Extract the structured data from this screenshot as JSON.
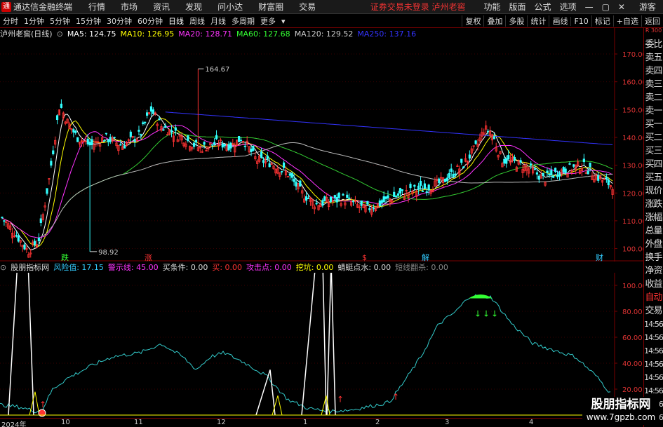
{
  "app": {
    "title": "通达信金融终端",
    "menu": [
      "行情",
      "市场",
      "资讯",
      "发现",
      "问小达",
      "财富圈",
      "交易"
    ],
    "notice": "证券交易未登录  泸州老窖",
    "right_menu": [
      "功能",
      "版面",
      "公式",
      "选项"
    ],
    "guest": "游客"
  },
  "toolbar": {
    "periods": [
      "分时",
      "1分钟",
      "5分钟",
      "15分钟",
      "30分钟",
      "60分钟",
      "日线",
      "周线",
      "月线",
      "多周期",
      "更多"
    ],
    "active_period": "日线",
    "right_buttons": [
      "复权",
      "叠加",
      "多股",
      "统计",
      "画线",
      "F10",
      "标记",
      "+自选",
      "返回"
    ]
  },
  "main_chart": {
    "stock": "泸州老窖(日线)",
    "ma": [
      {
        "label": "MA5: 124.75",
        "color": "#ffffff"
      },
      {
        "label": "MA10: 126.95",
        "color": "#ffff00"
      },
      {
        "label": "MA20: 128.71",
        "color": "#ff33ff"
      },
      {
        "label": "MA60: 127.68",
        "color": "#33ff33"
      },
      {
        "label": "MA120: 129.52",
        "color": "#cccccc"
      },
      {
        "label": "MA250: 137.16",
        "color": "#3333ff"
      }
    ],
    "price_axis": [
      "170.00",
      "160.00",
      "150.00",
      "140.00",
      "130.00",
      "120.00",
      "110.00",
      "100.00"
    ],
    "high_label": "164.67",
    "low_label": "98.92",
    "markers": [
      {
        "text": "跌",
        "color": "#33ff33"
      },
      {
        "text": "涨",
        "color": "#ff3333"
      },
      {
        "text": "$",
        "color": "#ff3333"
      },
      {
        "text": "解",
        "color": "#33ccff"
      },
      {
        "text": "财",
        "color": "#33ccff"
      }
    ]
  },
  "sub_chart": {
    "name": "股朋指标网",
    "fields": [
      {
        "label": "风险值: 17.15",
        "color": "#33ccff"
      },
      {
        "label": "警示线: 45.00",
        "color": "#ff33ff"
      },
      {
        "label": "买条件: 0.00",
        "color": "#dddddd"
      },
      {
        "label": "买: 0.00",
        "color": "#ff3333"
      },
      {
        "label": "攻击点: 0.00",
        "color": "#ff33ff"
      },
      {
        "label": "挖坑: 0.00",
        "color": "#ffff00"
      },
      {
        "label": "蜻蜓点水: 0.00",
        "color": "#dddddd"
      },
      {
        "label": "短线翻杀: 0.00",
        "color": "#888888"
      }
    ],
    "axis": [
      "100.00",
      "80.00",
      "60.00",
      "40.00",
      "20.00"
    ]
  },
  "x_axis": [
    "2024年",
    "10",
    "11",
    "12",
    "1",
    "2",
    "3",
    "4"
  ],
  "right_panel": {
    "top_note": "R 300",
    "items": [
      "委比",
      "卖五",
      "卖四",
      "卖三",
      "卖二",
      "卖一",
      "买一",
      "买二",
      "买三",
      "买四",
      "买五",
      "现价",
      "涨跌",
      "涨幅",
      "总量",
      "外盘",
      "换手",
      "净资",
      "收益",
      "自动",
      "交易",
      "14:56",
      "14:56",
      "14:56",
      "14:56",
      "14:56",
      "14:56",
      "14:56",
      "14:56"
    ]
  },
  "watermark": {
    "line1": "股朋指标网",
    "line2": "www.7gpzb.com"
  }
}
